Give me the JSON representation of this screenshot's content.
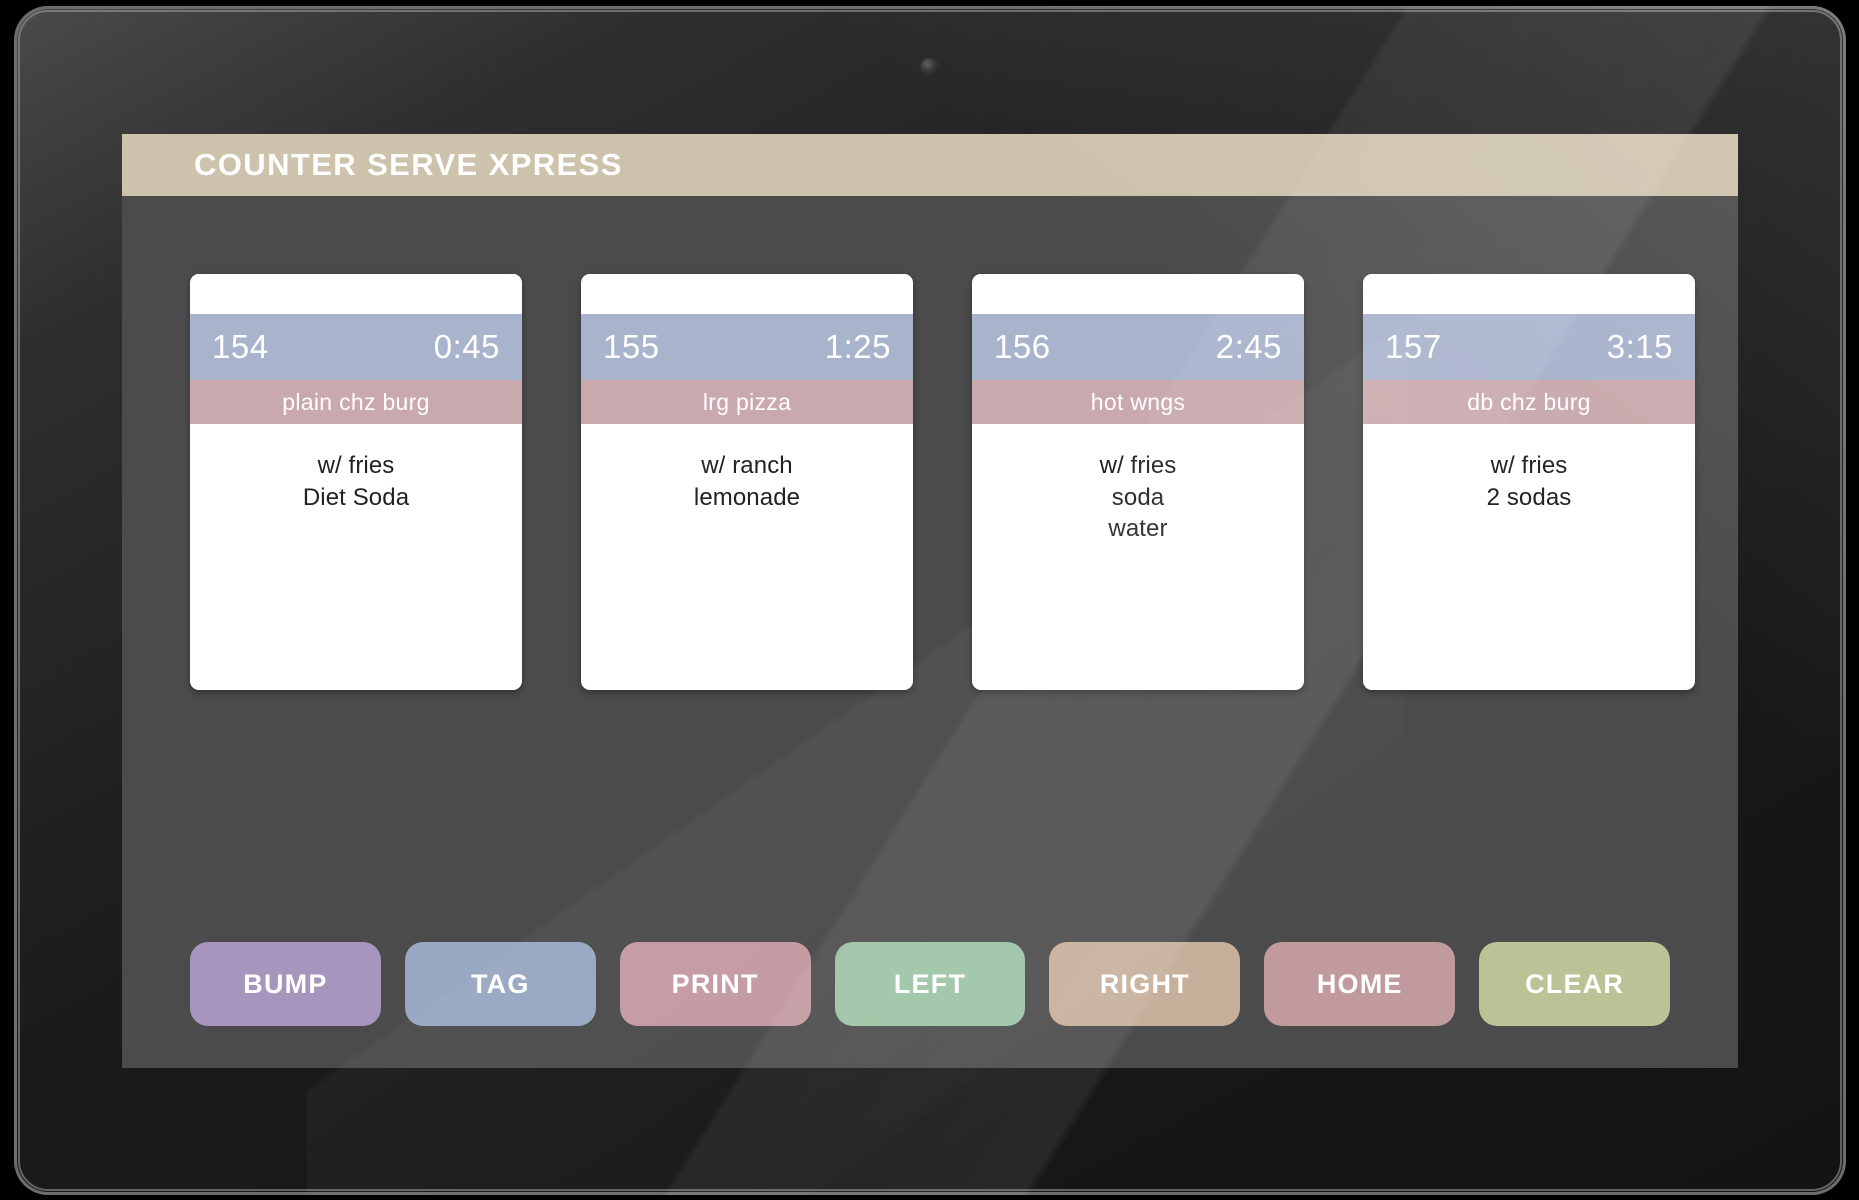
{
  "app": {
    "title": "COUNTER SERVE XPRESS",
    "header_bg": "#cdc2ab",
    "screen_bg": "#4b4b4b"
  },
  "ticket_style": {
    "header_bg": "#a8b3cc",
    "item_bg": "#c9a9ad",
    "body_bg": "#ffffff"
  },
  "tickets": [
    {
      "order_number": "154",
      "timer": "0:45",
      "item": "plain chz burg",
      "modifiers": [
        "w/ fries",
        "Diet Soda"
      ]
    },
    {
      "order_number": "155",
      "timer": "1:25",
      "item": "lrg pizza",
      "modifiers": [
        "w/ ranch",
        "lemonade"
      ]
    },
    {
      "order_number": "156",
      "timer": "2:45",
      "item": "hot wngs",
      "modifiers": [
        "w/ fries",
        "soda",
        "water"
      ]
    },
    {
      "order_number": "157",
      "timer": "3:15",
      "item": "db chz burg",
      "modifiers": [
        "w/ fries",
        "2 sodas"
      ]
    }
  ],
  "buttons": [
    {
      "label": "BUMP",
      "color": "#a696bd"
    },
    {
      "label": "TAG",
      "color": "#98a7c2"
    },
    {
      "label": "PRINT",
      "color": "#c49aa2"
    },
    {
      "label": "LEFT",
      "color": "#9cc3a4"
    },
    {
      "label": "RIGHT",
      "color": "#c6b09b"
    },
    {
      "label": "HOME",
      "color": "#c09a9c"
    },
    {
      "label": "CLEAR",
      "color": "#b9c395"
    }
  ]
}
